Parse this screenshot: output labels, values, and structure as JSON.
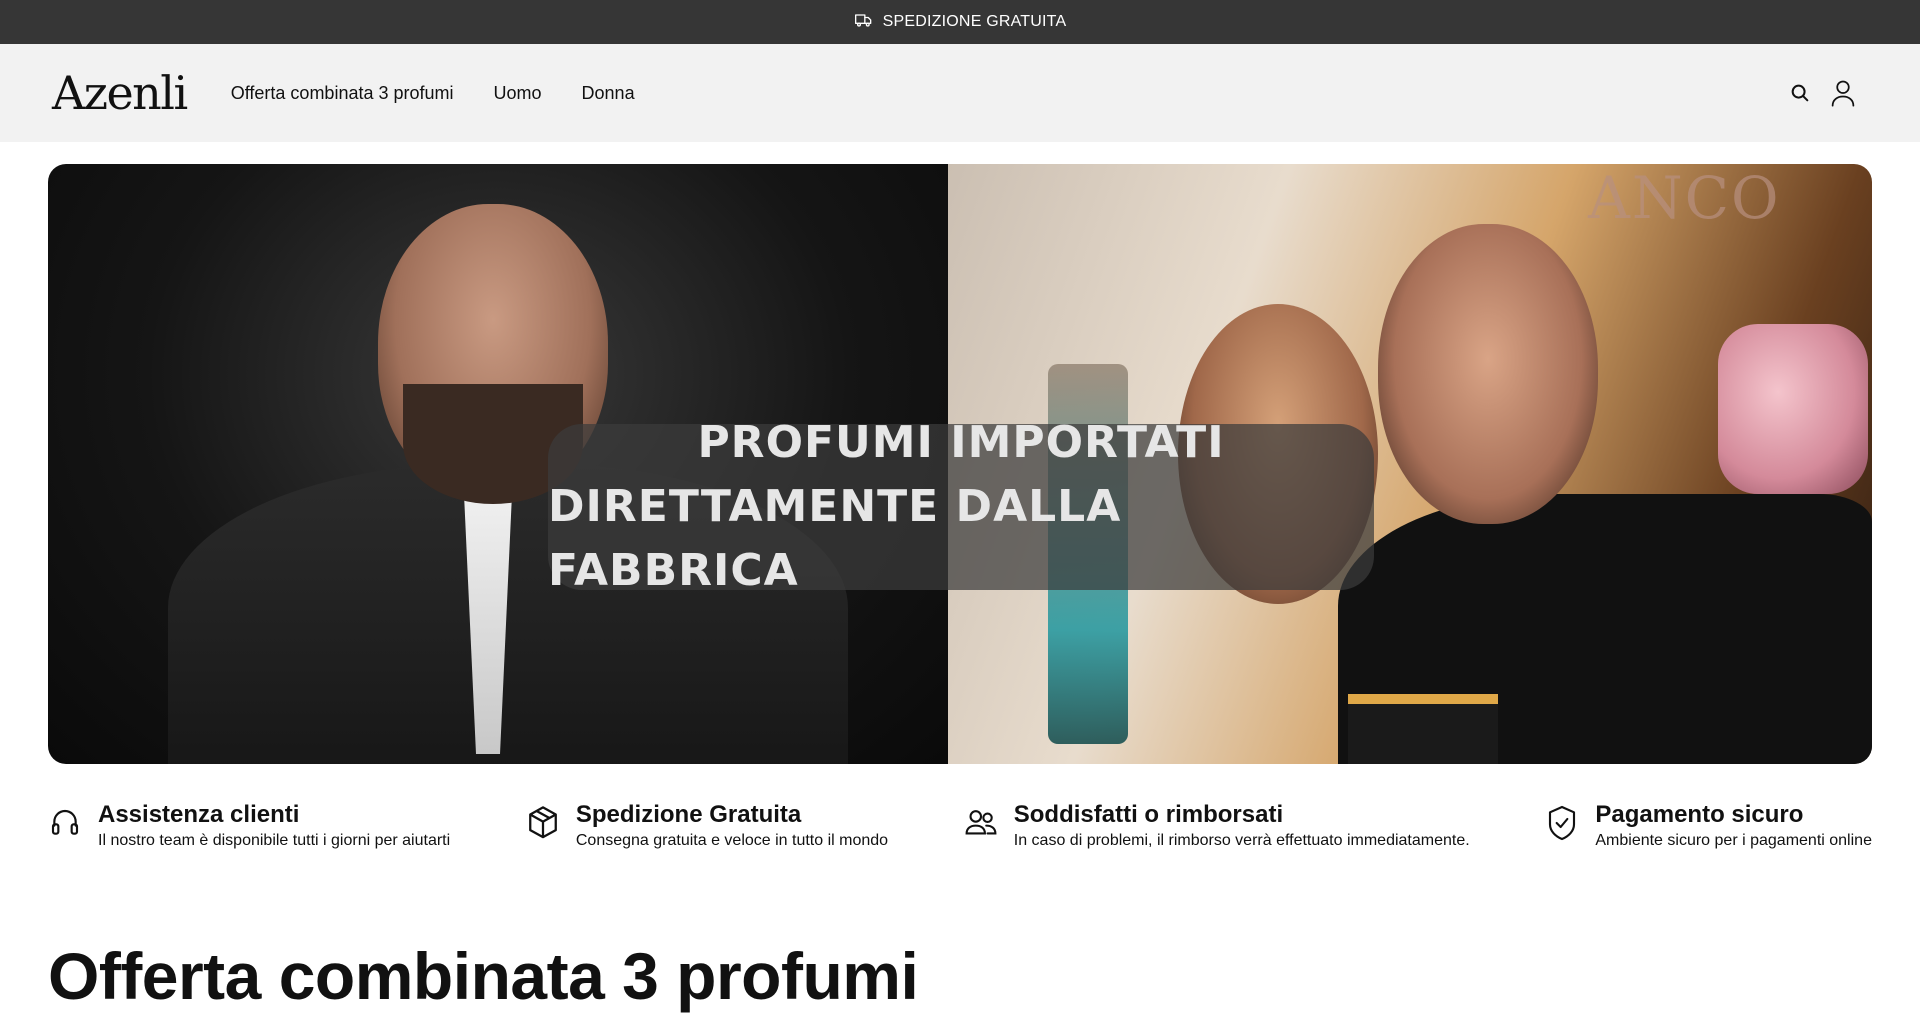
{
  "announcement": {
    "icon": "delivery-truck-icon",
    "text": "SPEDIZIONE GRATUITA"
  },
  "header": {
    "logo": "Azenli",
    "nav": [
      {
        "label": "Offerta combinata 3 profumi"
      },
      {
        "label": "Uomo"
      },
      {
        "label": "Donna"
      }
    ],
    "icons": [
      "search-icon",
      "account-icon"
    ]
  },
  "hero": {
    "headline_line1": "PROFUMI IMPORTATI",
    "headline_line2": "DIRETTAMENTE DALLA FABBRICA",
    "background_text": "ANCO"
  },
  "features": [
    {
      "icon": "headset-icon",
      "title": "Assistenza clienti",
      "description": "Il nostro team è disponibile tutti i giorni per aiutarti"
    },
    {
      "icon": "package-icon",
      "title": "Spedizione Gratuita",
      "description": "Consegna gratuita e veloce in tutto il mondo"
    },
    {
      "icon": "users-icon",
      "title": "Soddisfatti o rimborsati",
      "description": "In caso di problemi, il rimborso verrà effettuato immediatamente."
    },
    {
      "icon": "shield-check-icon",
      "title": "Pagamento sicuro",
      "description": "Ambiente sicuro per i pagamenti online"
    }
  ],
  "section": {
    "title": "Offerta combinata 3 profumi"
  },
  "colors": {
    "announcement_bg": "#363636",
    "header_bg": "#f2f2f2",
    "text": "#111111"
  }
}
